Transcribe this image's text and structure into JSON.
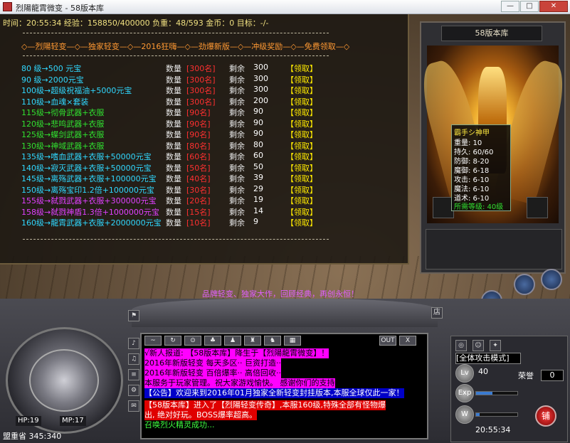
{
  "window": {
    "title": "烈陽龍霄微变 - 58版本库",
    "min_label": "—",
    "max_label": "□",
    "close_label": "✕"
  },
  "status": {
    "text": "时间：20:55:34 经验：158850/400000 负重：48/593 金币：0 目标：-/-"
  },
  "panel": {
    "headline": "◇—烈陽轻变—◇—独家轻变—◇—2016狂嗨—◇—劲爆新版—◇—冲级奖励—◇—免费领取—◇",
    "qty_label": "数量",
    "rem_label": "剩余",
    "claim_label": "【领取】",
    "rows": [
      {
        "level": "80 级→500 元宝",
        "qty": "[300名]",
        "rem": "300",
        "color": "#30d8ff"
      },
      {
        "level": "90 级→2000元宝",
        "qty": "[300名]",
        "rem": "300",
        "color": "#30d8ff"
      },
      {
        "level": "100级→超级祝福油+5000元宝",
        "qty": "[300名]",
        "rem": "300",
        "color": "#30d8ff"
      },
      {
        "level": "110级→血魂×套装",
        "qty": "[300名]",
        "rem": "200",
        "color": "#30d8ff"
      },
      {
        "level": "115级→彻骨武器+衣服",
        "qty": "[90名]",
        "rem": "90",
        "color": "#30e030"
      },
      {
        "level": "120级→悲鸣武器+衣服",
        "qty": "[90名]",
        "rem": "90",
        "color": "#30e030"
      },
      {
        "level": "125级→蝶剑武器+衣服",
        "qty": "[90名]",
        "rem": "90",
        "color": "#30e030"
      },
      {
        "level": "130级→神域武器+衣服",
        "qty": "[80名]",
        "rem": "80",
        "color": "#30e030"
      },
      {
        "level": "135级→嗜血武器+衣服+50000元宝",
        "qty": "[60名]",
        "rem": "60",
        "color": "#30d8ff"
      },
      {
        "level": "140级→寂灭武器+衣服+50000元宝",
        "qty": "[50名]",
        "rem": "50",
        "color": "#30d8ff"
      },
      {
        "level": "145级→离殇武器+衣服+100000元宝",
        "qty": "[40名]",
        "rem": "39",
        "color": "#30d8ff"
      },
      {
        "level": "150级→离殇宝印1.2倍+100000元宝",
        "qty": "[30名]",
        "rem": "29",
        "color": "#30d8ff"
      },
      {
        "level": "155级→弑戮武器+衣服+300000元宝",
        "qty": "[20名]",
        "rem": "19",
        "color": "#e040ff"
      },
      {
        "level": "158级→弑戮神盾1.3倍+1000000元宝",
        "qty": "[15名]",
        "rem": "14",
        "color": "#e040ff"
      },
      {
        "level": "160级→龍霄武器+衣服+2000000元宝",
        "qty": "[10名]",
        "rem": "9",
        "color": "#30d8ff"
      }
    ]
  },
  "equip": {
    "header": "58版本库",
    "item": {
      "name": "霸手シ神甲",
      "stats": [
        "重量: 10",
        "持久: 60/60",
        "防御: 8-20",
        "魔御: 6-18",
        "攻击: 6-10",
        "魔法: 6-10",
        "道术: 6-10"
      ],
      "requirement": "所需等级: 40级"
    }
  },
  "banner": "品牌轻变、独家大作，回顾经典，再创永恒！",
  "chat": {
    "toolbar_out": "OUT",
    "toolbar_close": "X",
    "messages": [
      {
        "text": "√新人报道: 【58版本库】降生于【烈陽龍霄微变】！",
        "style": "m-mag"
      },
      {
        "text": "2016年新版轻变  每天多区··  巨资打造··",
        "style": "m-mag"
      },
      {
        "text": "2016年新版轻变  百倍爆率··  高倍回收··",
        "style": "m-mag"
      },
      {
        "text": "本服务于玩家管理。祝大家游戏愉快。 感谢你们的支持",
        "style": "m-mag"
      },
      {
        "text": "【公告】欢迎来到2016年01月独家全新轻变封挂版本,本服全球仅此一家！",
        "style": "m-blue"
      },
      {
        "text": "【58版本库】进入了【烈陽轻变传奇】,本服160级,特殊全部有怪物爆",
        "style": "m-red"
      },
      {
        "text": "出, 绝对好玩。BOSS爆率超高。",
        "style": "m-red"
      },
      {
        "text": "召唤烈火精灵成功...",
        "style": "m-grn"
      }
    ]
  },
  "hud": {
    "hp": "HP:19",
    "mp": "MP:17",
    "coords": "盟重省 345:340",
    "attack_mode": "[全体攻击模式]",
    "lv_label": "Lv",
    "lv_value": "40",
    "exp_label": "Exp",
    "wt_label": "W",
    "honor_label": "荣誉",
    "honor_value": "0",
    "clock": "20:55:34",
    "shop_label": "铺",
    "store_label": "店"
  }
}
